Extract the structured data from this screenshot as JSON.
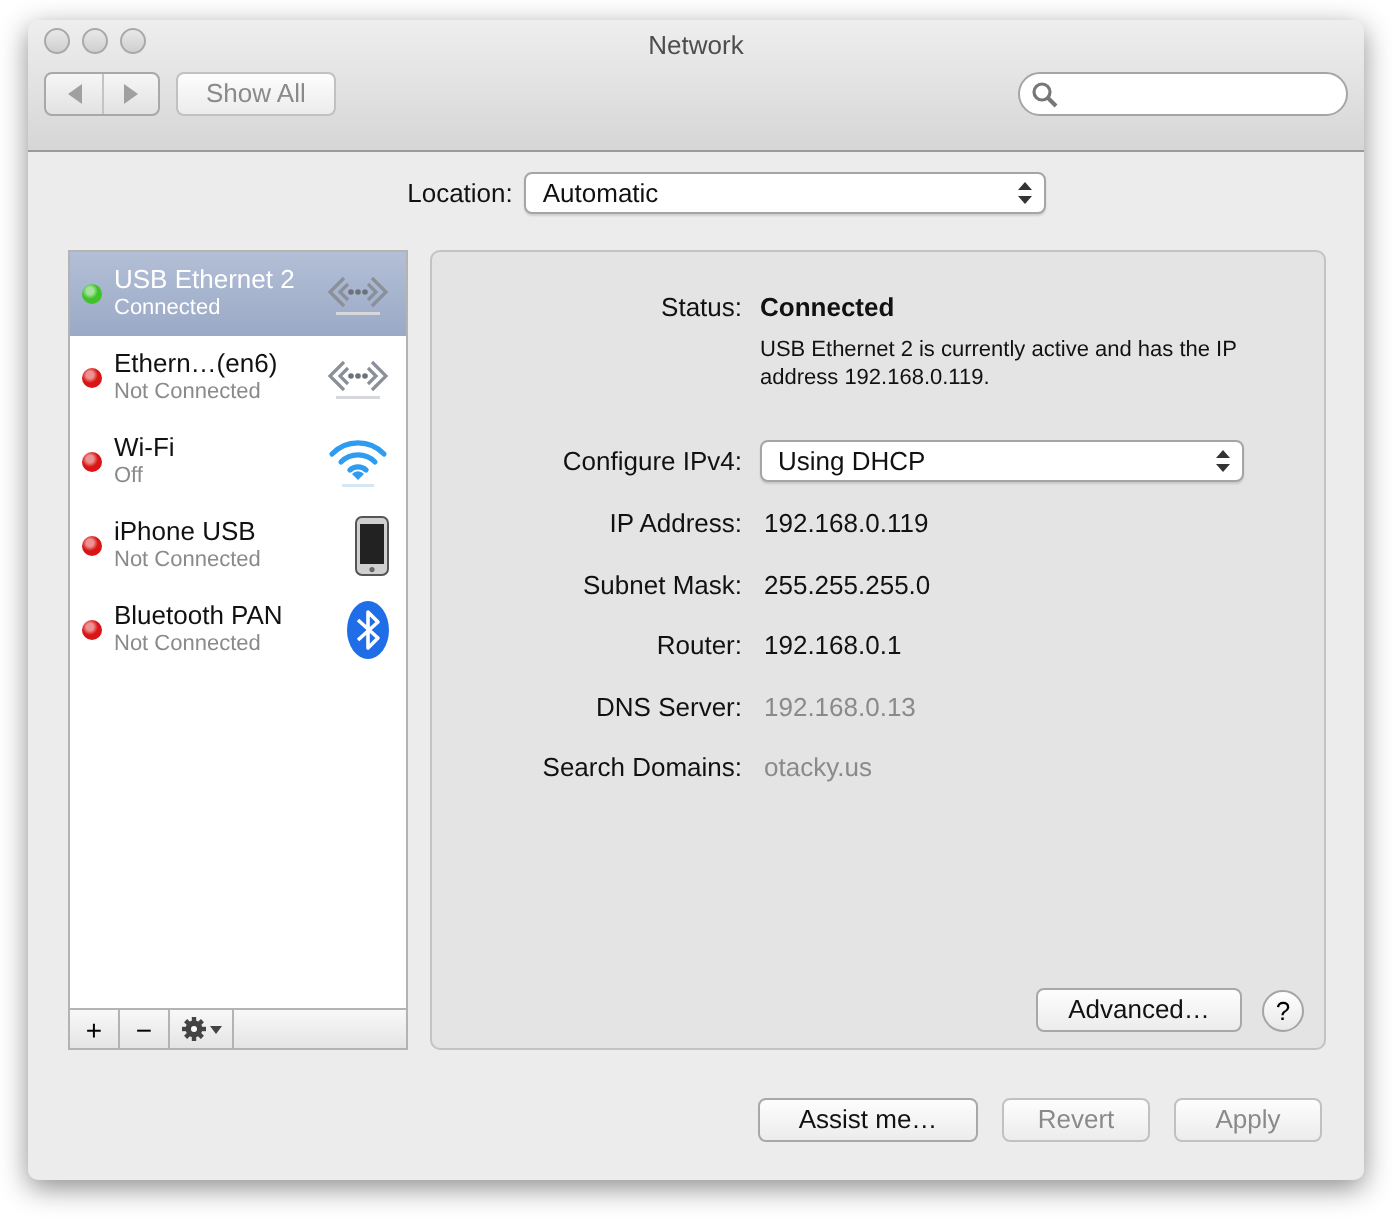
{
  "window": {
    "title": "Network"
  },
  "toolbar": {
    "back": {
      "disabled": true
    },
    "forward": {
      "disabled": true
    },
    "show_all": {
      "label": "Show All",
      "disabled": true
    }
  },
  "location": {
    "label": "Location:",
    "value": "Automatic"
  },
  "services": [
    {
      "name": "USB Ethernet 2",
      "status": "Connected",
      "selected": true,
      "color": "#3fc22a",
      "kind": "ethernet"
    },
    {
      "name": "Ethern…(en6)",
      "status": "Not Connected",
      "selected": false,
      "color": "#d91515",
      "kind": "ethernet"
    },
    {
      "name": "Wi-Fi",
      "status": "Off",
      "selected": false,
      "color": "#d91515",
      "kind": "wifi"
    },
    {
      "name": "iPhone USB",
      "status": "Not Connected",
      "selected": false,
      "color": "#d91515",
      "kind": "phone"
    },
    {
      "name": "Bluetooth PAN",
      "status": "Not Connected",
      "selected": false,
      "color": "#d91515",
      "kind": "bluetooth"
    }
  ],
  "list_buttons": {
    "add": "+",
    "remove": "−"
  },
  "detail": {
    "status_label": "Status:",
    "status_value": "Connected",
    "status_description": "USB Ethernet 2 is currently active and has the IP address 192.168.0.119.",
    "configure": {
      "label": "Configure IPv4:",
      "value": "Using DHCP"
    },
    "fields": [
      {
        "label": "IP Address:",
        "value": "192.168.0.119",
        "dimmed": false
      },
      {
        "label": "Subnet Mask:",
        "value": "255.255.255.0",
        "dimmed": false
      },
      {
        "label": "Router:",
        "value": "192.168.0.1",
        "dimmed": false
      },
      {
        "label": "DNS Server:",
        "value": "192.168.0.13",
        "dimmed": true
      },
      {
        "label": "Search Domains:",
        "value": "otacky.us",
        "dimmed": true
      }
    ],
    "advanced": "Advanced…",
    "help": "?"
  },
  "footer_buttons": [
    {
      "label": "Assist me…",
      "disabled": false
    },
    {
      "label": "Revert",
      "disabled": true
    },
    {
      "label": "Apply",
      "disabled": true
    }
  ]
}
